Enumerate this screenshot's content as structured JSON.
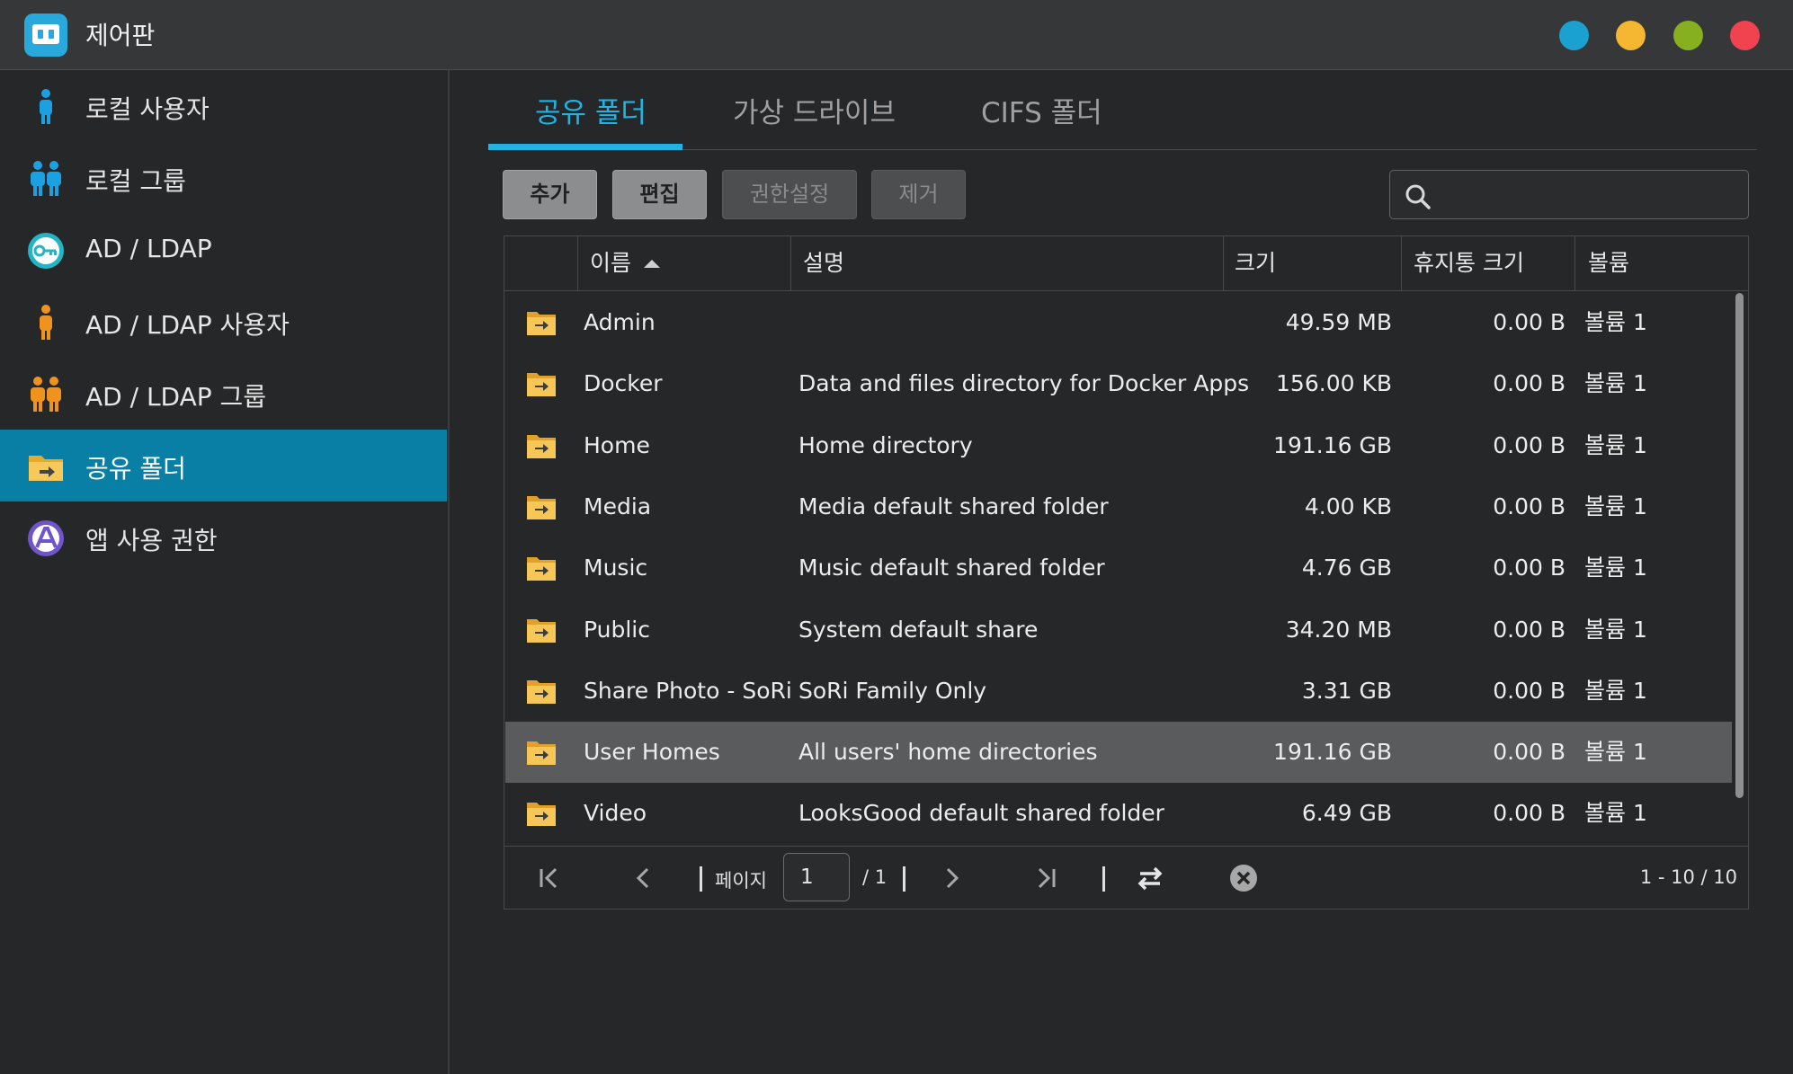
{
  "app": {
    "title": "제어판"
  },
  "window_buttons": [
    {
      "name": "info",
      "color": "#1aa1cf"
    },
    {
      "name": "minimize",
      "color": "#f5b631"
    },
    {
      "name": "maximize",
      "color": "#86b01f"
    },
    {
      "name": "close",
      "color": "#f0424f"
    }
  ],
  "sidebar": {
    "items": [
      {
        "label": "로컬 사용자",
        "icon": "user-icon",
        "active": false
      },
      {
        "label": "로컬 그룹",
        "icon": "group-icon",
        "active": false
      },
      {
        "label": "AD / LDAP",
        "icon": "key-icon",
        "active": false
      },
      {
        "label": "AD / LDAP 사용자",
        "icon": "user-icon",
        "active": false
      },
      {
        "label": "AD / LDAP 그룹",
        "icon": "group-icon",
        "active": false
      },
      {
        "label": "공유 폴더",
        "icon": "shared-folder-icon",
        "active": true
      },
      {
        "label": "앱 사용 권한",
        "icon": "app-permission-icon",
        "active": false
      }
    ]
  },
  "tabs": [
    {
      "label": "공유 폴더",
      "active": true
    },
    {
      "label": "가상 드라이브",
      "active": false
    },
    {
      "label": "CIFS 폴더",
      "active": false
    }
  ],
  "toolbar": {
    "add": "추가",
    "edit": "편집",
    "permission": "권한설정",
    "remove": "제거",
    "search_placeholder": ""
  },
  "table": {
    "columns": {
      "name": "이름",
      "description": "설명",
      "size": "크기",
      "trash_size": "휴지통 크기",
      "volume": "볼륨"
    },
    "sort": {
      "column": "name",
      "direction": "ascending"
    },
    "rows": [
      {
        "name": "Admin",
        "description": "",
        "size": "49.59 MB",
        "trash": "0.00 B",
        "volume": "볼륨 1",
        "selected": false
      },
      {
        "name": "Docker",
        "description": "Data and files directory for Docker Apps",
        "size": "156.00 KB",
        "trash": "0.00 B",
        "volume": "볼륨 1",
        "selected": false
      },
      {
        "name": "Home",
        "description": "Home directory",
        "size": "191.16 GB",
        "trash": "0.00 B",
        "volume": "볼륨 1",
        "selected": false
      },
      {
        "name": "Media",
        "description": "Media default shared folder",
        "size": "4.00 KB",
        "trash": "0.00 B",
        "volume": "볼륨 1",
        "selected": false
      },
      {
        "name": "Music",
        "description": "Music default shared folder",
        "size": "4.76 GB",
        "trash": "0.00 B",
        "volume": "볼륨 1",
        "selected": false
      },
      {
        "name": "Public",
        "description": "System default share",
        "size": "34.20 MB",
        "trash": "0.00 B",
        "volume": "볼륨 1",
        "selected": false
      },
      {
        "name": "Share Photo - SoRi",
        "description": "SoRi Family Only",
        "size": "3.31 GB",
        "trash": "0.00 B",
        "volume": "볼륨 1",
        "selected": false
      },
      {
        "name": "User Homes",
        "description": "All users' home directories",
        "size": "191.16 GB",
        "trash": "0.00 B",
        "volume": "볼륨 1",
        "selected": true
      },
      {
        "name": "Video",
        "description": "LooksGood default shared folder",
        "size": "6.49 GB",
        "trash": "0.00 B",
        "volume": "볼륨 1",
        "selected": false
      }
    ]
  },
  "pager": {
    "page_label": "페이지",
    "current_page": "1",
    "total_pages": "/ 1",
    "range": "1 - 10 / 10"
  },
  "colors": {
    "accent": "#21b4e3",
    "active_nav": "#0a7fa5",
    "folder": "#f2b93a",
    "selected_row": "#5a5b5c"
  }
}
